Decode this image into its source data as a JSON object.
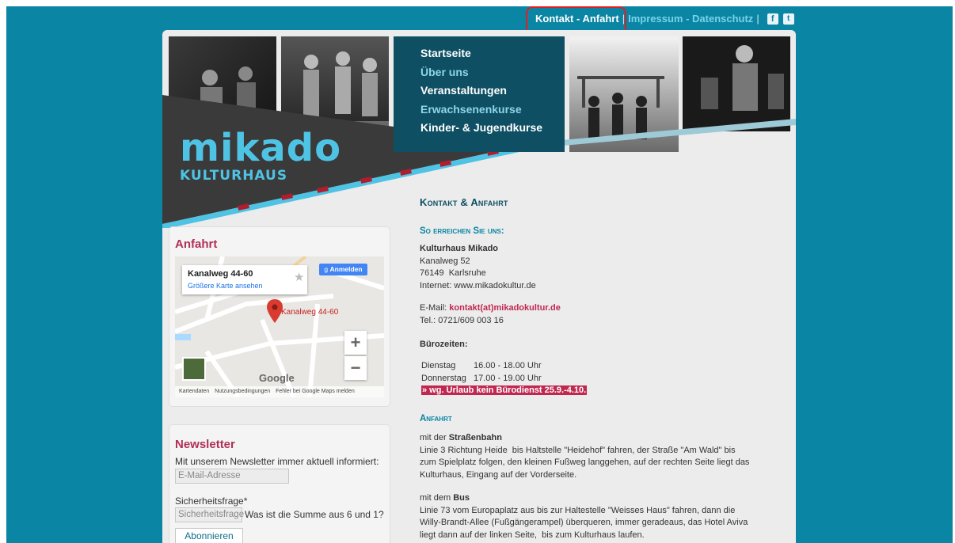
{
  "top_nav": {
    "contact": "Kontakt - Anfahrt",
    "separator": "|",
    "imprint": "Impressum",
    "dash": " - ",
    "privacy": "Datenschutz",
    "facebook_icon": "facebook-icon",
    "twitter_icon": "twitter-icon"
  },
  "main_nav": {
    "items": [
      "Startseite",
      "Über uns",
      "Veranstaltungen",
      "Erwachsenenkurse",
      "Kinder- & Jugendkurse"
    ]
  },
  "logo": {
    "line1": "mikado",
    "line2": "KULTURHAUS"
  },
  "anfahrt_box": {
    "title": "Anfahrt",
    "map": {
      "place_title": "Kanalweg 44-60",
      "larger_map_link": "Größere Karte ansehen",
      "sign_in": "Anmelden",
      "marker_label": "Kanalweg 44-60",
      "zoom_in": "+",
      "zoom_out": "−",
      "google": "Google",
      "footer": [
        "Kartendaten",
        "Nutzungsbedingungen",
        "Fehler bei Google Maps melden"
      ]
    }
  },
  "newsletter": {
    "title": "Newsletter",
    "intro": "Mit unserem Newsletter immer aktuell informiert:",
    "email_placeholder": "E-Mail-Adresse",
    "security_label": "Sicherheitsfrage*",
    "security_placeholder": "Sicherheitsfrage",
    "security_question": "Was ist die Summe aus 6 und 1?",
    "subscribe": "Abonnieren"
  },
  "content": {
    "heading": "Kontakt & Anfahrt",
    "reach_heading": "So erreichen Sie uns:",
    "org_name": "Kulturhaus Mikado",
    "street": "Kanalweg 52",
    "city": "76149  Karlsruhe",
    "internet": "Internet: www.mikadokultur.de",
    "email_label": "E-Mail: ",
    "email": "kontakt(at)mikadokultur.de",
    "phone": "Tel.: 0721/609 003 16",
    "office_hours_title": "Bürozeiten:",
    "office_hours": [
      {
        "day": "Dienstag",
        "time": "16.00 - 18.00 Uhr"
      },
      {
        "day": "Donnerstag",
        "time": "17.00 - 19.00 Uhr"
      }
    ],
    "holiday_note": "» wg. Urlaub kein Bürodienst 25.9.-4.10.",
    "anfahrt_heading": "Anfahrt",
    "tram_prefix": "mit der ",
    "tram_bold": "Straßenbahn",
    "tram_lines": [
      "Linie 3 Richtung Heide  bis Haltstelle \"Heidehof\" fahren, der Straße \"Am Wald\" bis",
      "zum Spielplatz folgen, den kleinen Fußweg langgehen, auf der rechten Seite liegt das",
      "Kulturhaus, Eingang auf der Vorderseite."
    ],
    "bus_prefix": "mit dem ",
    "bus_bold": "Bus",
    "bus_lines": [
      "Linie 73 vom Europaplatz aus bis zur Haltestelle \"Weisses Haus\" fahren, dann die",
      "Willy-Brandt-Allee (Fußgängerampel) überqueren, immer geradeaus, das Hotel Aviva",
      "liegt dann auf der linken Seite,  bis zum Kulturhaus laufen."
    ]
  },
  "colors": {
    "background_teal": "#0a85a3",
    "nav_dark": "#0e4f63",
    "accent_red": "#c02850",
    "logo_cyan": "#4ec3e3",
    "highlight_box": "#e02020"
  }
}
